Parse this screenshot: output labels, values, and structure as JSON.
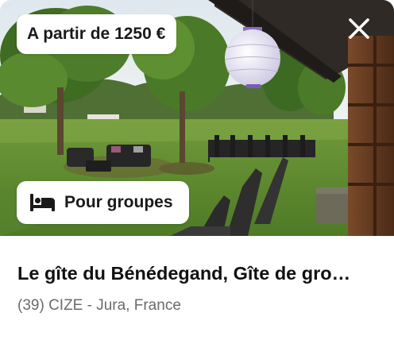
{
  "listing": {
    "price_label": "A partir de 1250 €",
    "tag_label": "Pour groupes",
    "title": "Le gîte du Bénédegand, Gîte de gro…",
    "location": "(39) CIZE - Jura, France"
  },
  "icons": {
    "close": "close-icon",
    "tag": "bed-icon"
  },
  "colors": {
    "card_background": "#ffffff",
    "title_text": "#111111",
    "location_text": "#6b6b6b",
    "badge_background": "#ffffff"
  }
}
